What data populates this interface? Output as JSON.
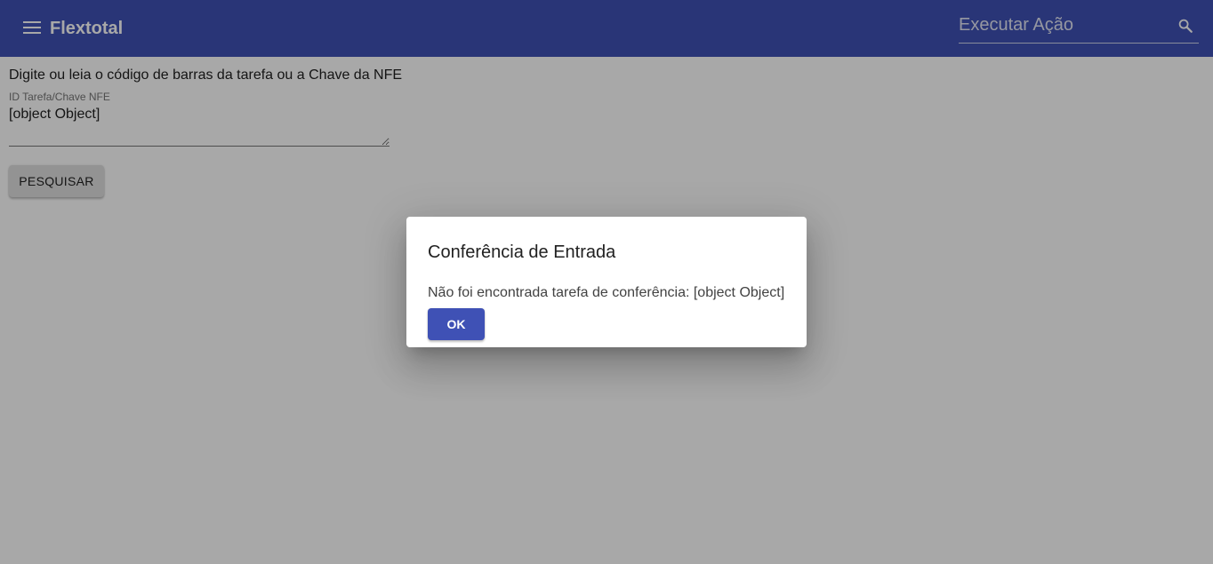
{
  "appbar": {
    "title": "Flextotal",
    "background_color": "#3f51b5",
    "menu_icon": "hamburger-menu-icon",
    "search_placeholder": "Executar Ação",
    "search_icon": "search-icon"
  },
  "main": {
    "instruction": "Digite ou leia o código de barras da tarefa ou a Chave da NFE",
    "field_label": "ID Tarefa/Chave NFE",
    "field_value": "[object Object]",
    "search_button_label": "PESQUISAR"
  },
  "dialog": {
    "title": "Conferência de Entrada",
    "message": "Não foi encontrada tarefa de conferência: [object Object]",
    "ok_label": "OK",
    "ok_color": "#3f51b5"
  }
}
